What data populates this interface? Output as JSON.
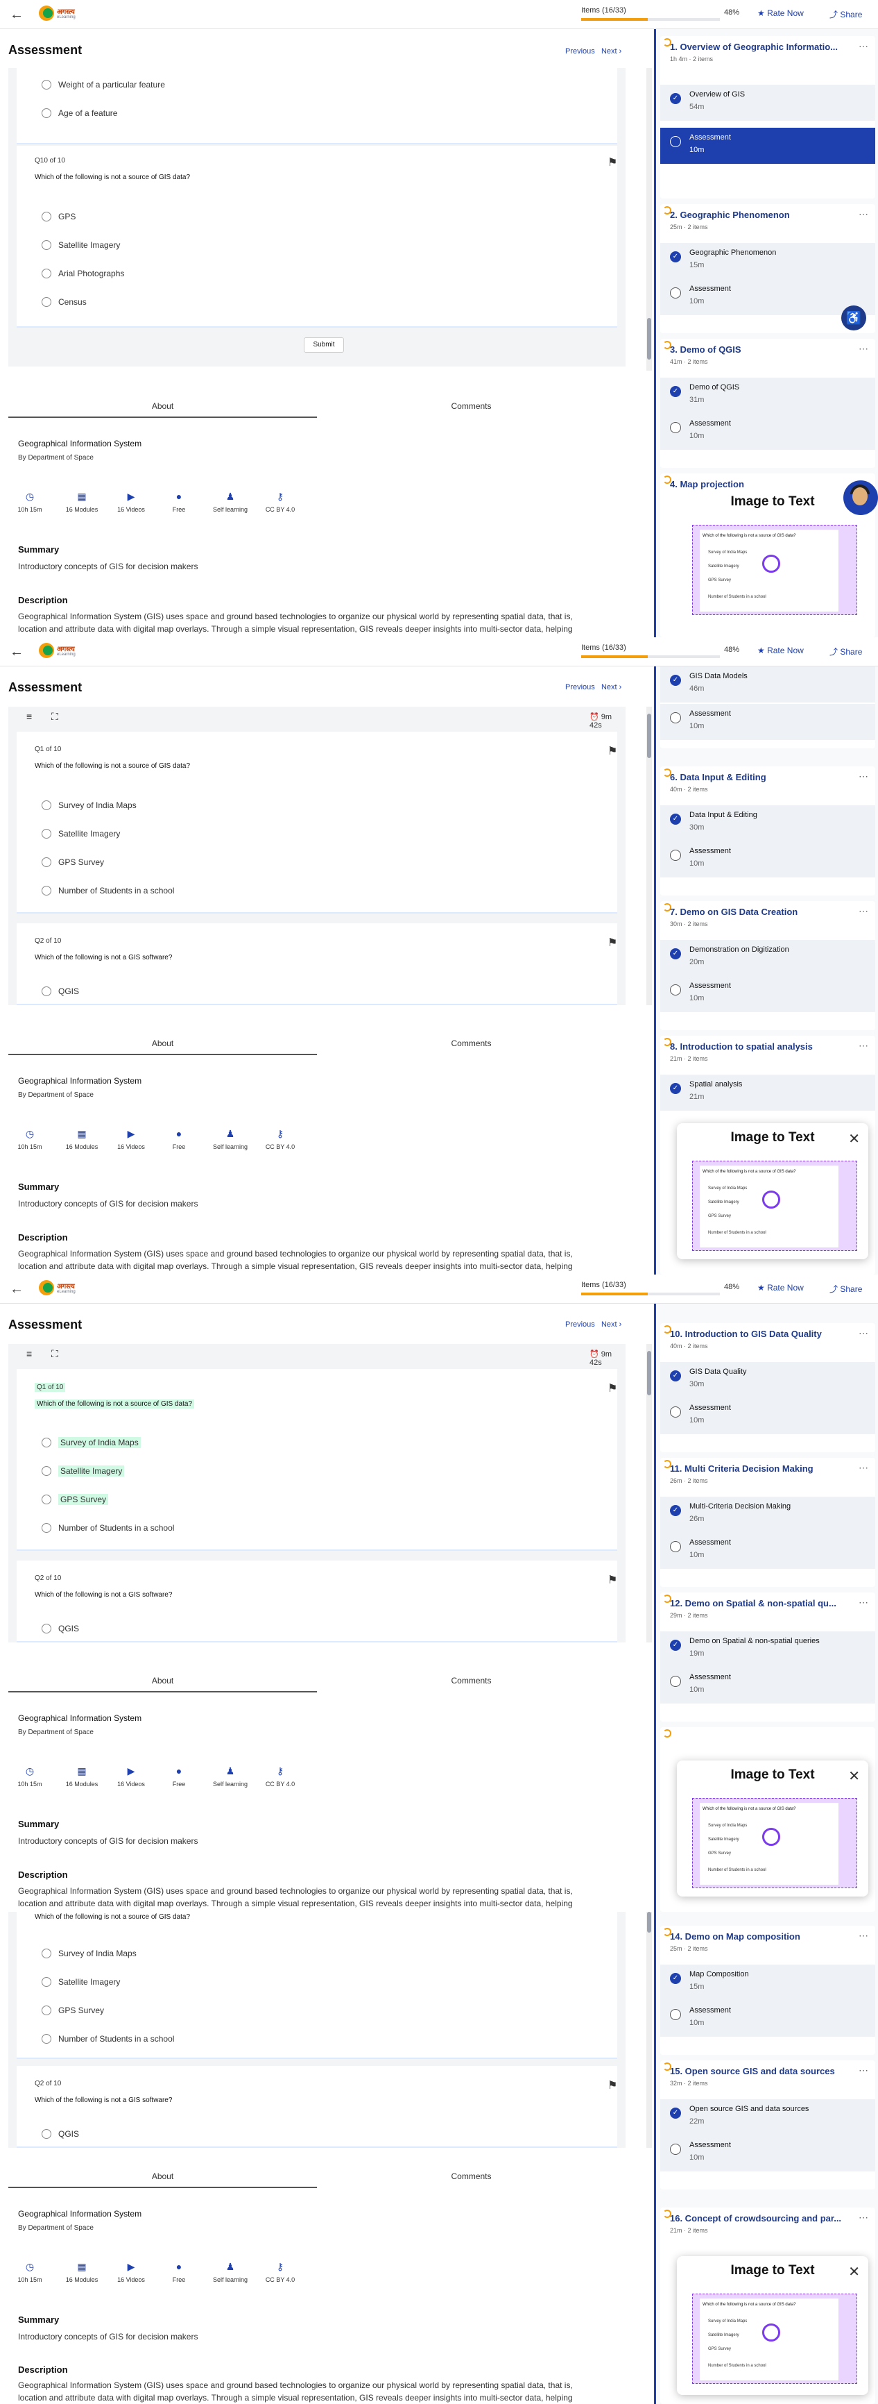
{
  "header": {
    "items_label": "Items (16/33)",
    "progress_pct": "48%",
    "progress_value": 0.48,
    "rate_label": "Rate Now",
    "share_label": "Share"
  },
  "main": {
    "title": "Assessment",
    "previous": "Previous",
    "next": "Next",
    "timer": "9m 42s",
    "submit": "Submit",
    "q_top_opts": [
      "Weight of a particular feature",
      "Age of a feature"
    ],
    "q1": {
      "num": "Q1 of 10",
      "text": "Which of the following is not a source of GIS data?",
      "options": [
        "Survey of India Maps",
        "Satellite Imagery",
        "GPS Survey",
        "Number of Students in a school"
      ]
    },
    "q2": {
      "num": "Q2 of 10",
      "text": "Which of the following is not a GIS software?",
      "options": [
        "QGIS"
      ]
    },
    "q10": {
      "num": "Q10 of 10",
      "text": "Which of the following is not a source of GIS data?",
      "options": [
        "GPS",
        "Satellite Imagery",
        "Arial Photographs",
        "Census"
      ]
    }
  },
  "about": {
    "tab_about": "About",
    "tab_comments": "Comments",
    "course": "Geographical Information System",
    "dept": "By Department of Space",
    "stats": [
      "10h 15m",
      "16 Modules",
      "16 Videos",
      "Free",
      "Self learning",
      "CC BY 4.0"
    ],
    "summary_h": "Summary",
    "summary": "Introductory concepts of GIS for decision makers",
    "desc_h": "Description",
    "desc1": "Geographical Information System (GIS) uses space and ground based technologies to organize our physical world by representing spatial data, that is,",
    "desc2": "location and attribute data with digital map overlays. Through a simple visual representation, GIS reveals deeper insights into multi-sector data, helping",
    "desc2b": "location and attribute data with digital map overlays. Through a simple visual representation, GIS reveals deeper insights into multi-sector data, helping"
  },
  "popup": {
    "title": "Image to Text",
    "close": "✕"
  },
  "sidebar": {
    "items_label": "2 items",
    "assessment": "Assessment",
    "s1": [
      {
        "title": "1. Overview of Geographic Informatio...",
        "meta": "1h 4m",
        "first": "Overview of GIS",
        "d1": "54m",
        "d2": "10m"
      },
      {
        "title": "2. Geographic Phenomenon",
        "meta": "25m",
        "first": "Geographic Phenomenon",
        "d1": "15m",
        "d2": "10m"
      },
      {
        "title": "3. Demo of QGIS",
        "meta": "41m",
        "first": "Demo of QGIS",
        "d1": "31m",
        "d2": "10m"
      },
      {
        "title": "4. Map projection",
        "meta": "",
        "first": "",
        "d1": "",
        "d2": ""
      }
    ],
    "s2_top": {
      "first": "GIS Data Models",
      "d1": "46m",
      "d2": "10m"
    },
    "s2": [
      {
        "title": "6. Data Input & Editing",
        "meta": "40m",
        "first": "Data Input & Editing",
        "d1": "30m",
        "d2": "10m"
      },
      {
        "title": "7. Demo on GIS Data Creation",
        "meta": "30m",
        "first": "Demonstration on Digitization",
        "d1": "20m",
        "d2": "10m"
      },
      {
        "title": "8. Introduction to spatial analysis",
        "meta": "21m",
        "first": "Spatial analysis",
        "d1": "21m",
        "d2": ""
      }
    ],
    "s3": [
      {
        "title": "10. Introduction to GIS Data Quality",
        "meta": "40m",
        "first": "GIS Data Quality",
        "d1": "30m",
        "d2": "10m"
      },
      {
        "title": "11. Multi Criteria Decision Making",
        "meta": "26m",
        "first": "Multi-Criteria Decision Making",
        "d1": "26m",
        "d2": "10m"
      },
      {
        "title": "12. Demo on Spatial & non-spatial qu...",
        "meta": "29m",
        "first": "Demo on Spatial & non-spatial queries",
        "d1": "19m",
        "d2": "10m"
      }
    ],
    "s4": [
      {
        "title": "14. Demo on Map composition",
        "meta": "25m",
        "first": "Map Composition",
        "d1": "15m",
        "d2": "10m"
      },
      {
        "title": "15. Open source GIS and data sources",
        "meta": "32m",
        "first": "Open source GIS and data sources",
        "d1": "22m",
        "d2": "10m"
      },
      {
        "title": "16. Concept of crowdsourcing and par...",
        "meta": "21m",
        "first": "",
        "d1": "",
        "d2": ""
      }
    ]
  }
}
